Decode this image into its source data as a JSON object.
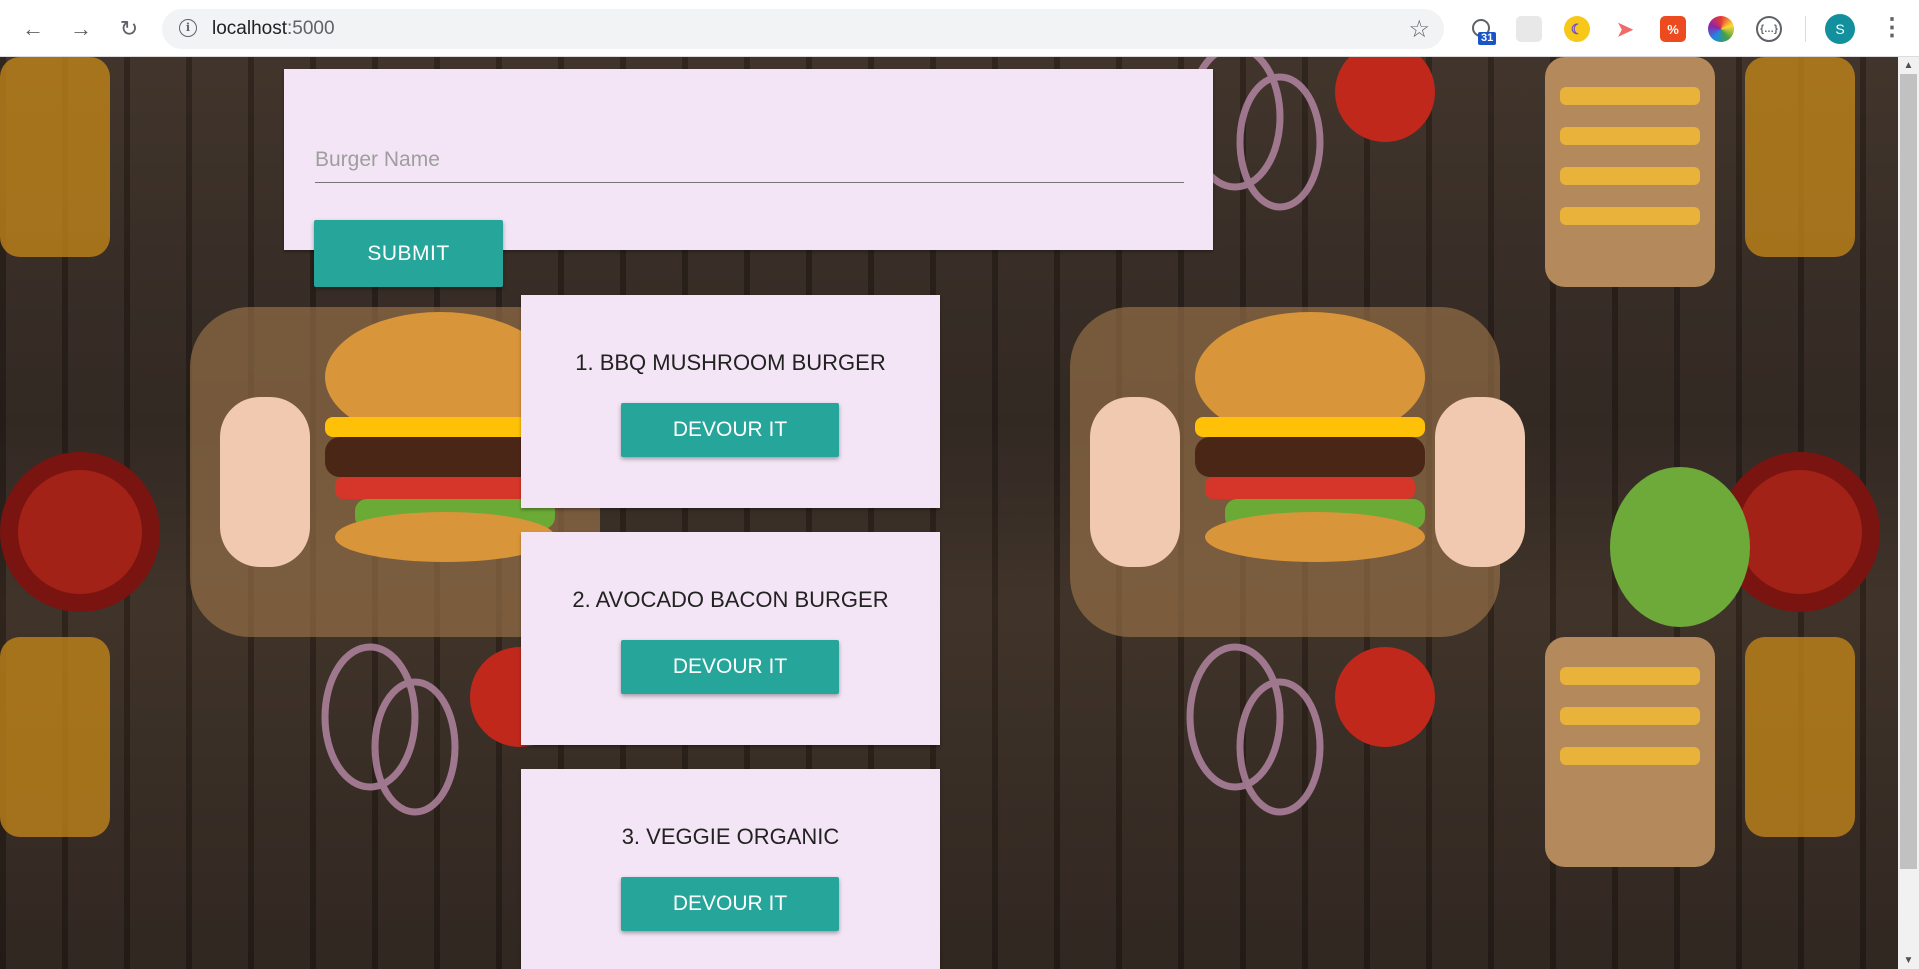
{
  "browser": {
    "url_host": "localhost",
    "url_port": ":5000",
    "extension_badge": "31",
    "profile_initial": "S"
  },
  "form": {
    "input_placeholder": "Burger Name",
    "input_value": "",
    "submit_label": "SUBMIT"
  },
  "burgers": [
    {
      "label": "1. BBQ MUSHROOM BURGER",
      "button": "DEVOUR IT"
    },
    {
      "label": "2. AVOCADO BACON BURGER",
      "button": "DEVOUR IT"
    },
    {
      "label": "3. VEGGIE ORGANIC",
      "button": "DEVOUR IT"
    }
  ],
  "colors": {
    "card_background": "#f3e5f5",
    "button_teal": "#26a69a",
    "wood_background": "#3b2e25"
  },
  "icons": {
    "back": "back-arrow-icon",
    "forward": "forward-arrow-icon",
    "reload": "reload-icon",
    "info": "info-icon",
    "bookmark": "star-icon",
    "menu": "kebab-menu-icon"
  }
}
